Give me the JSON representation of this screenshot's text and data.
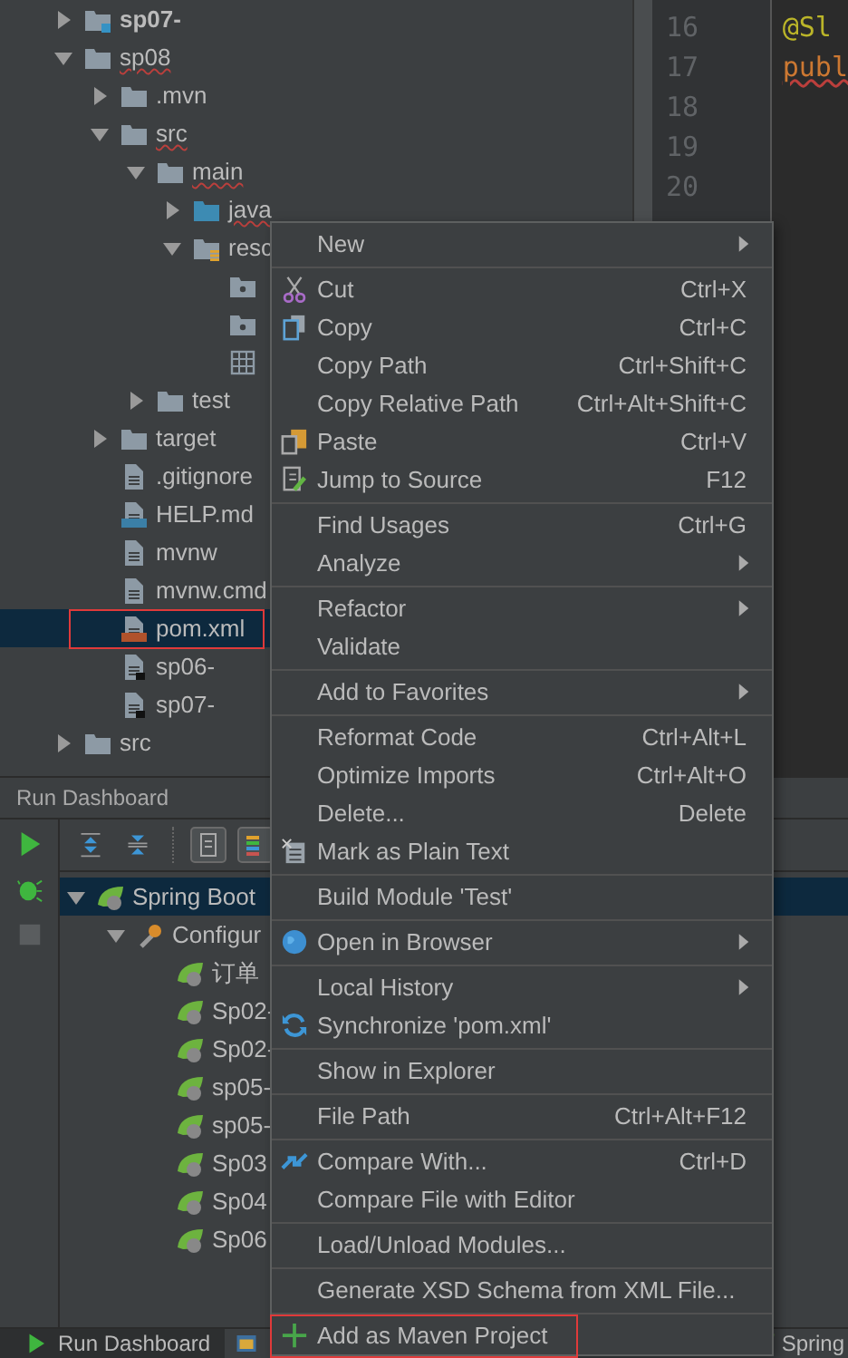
{
  "project_tree": [
    {
      "label": "sp07-",
      "kind": "module",
      "bold": true,
      "expanded": false,
      "selected": false
    },
    {
      "label": "sp08",
      "kind": "folder",
      "error": true,
      "expanded": true,
      "selected": false,
      "children": [
        {
          "label": ".mvn",
          "kind": "folder",
          "expanded": false,
          "selected": false
        },
        {
          "label": "src",
          "kind": "folder",
          "error": true,
          "expanded": true,
          "selected": false,
          "children": [
            {
              "label": "main",
              "kind": "folder",
              "error": true,
              "expanded": true,
              "selected": false,
              "children": [
                {
                  "label": "java",
                  "kind": "source",
                  "error": true,
                  "expanded": false,
                  "selected": false
                },
                {
                  "label": "resc",
                  "kind": "resources",
                  "expanded": true,
                  "selected": false,
                  "children": [
                    {
                      "kind": "package",
                      "selected": false
                    },
                    {
                      "kind": "package",
                      "selected": false
                    },
                    {
                      "kind": "table",
                      "selected": false
                    }
                  ]
                }
              ]
            },
            {
              "label": "test",
              "kind": "folder",
              "expanded": false,
              "selected": false
            }
          ]
        },
        {
          "label": "target",
          "kind": "folder",
          "expanded": false,
          "selected": false
        },
        {
          "label": ".gitignore",
          "kind": "file",
          "selected": false
        },
        {
          "label": "HELP.md",
          "kind": "md",
          "selected": false
        },
        {
          "label": "mvnw",
          "kind": "file",
          "selected": false
        },
        {
          "label": "mvnw.cmd",
          "kind": "file",
          "selected": false
        },
        {
          "label": "pom.xml",
          "kind": "xml",
          "selected": true,
          "marked": true
        },
        {
          "label": "sp06-",
          "kind": "module-file",
          "selected": false
        },
        {
          "label": "sp07-",
          "kind": "module-file",
          "selected": false
        }
      ]
    },
    {
      "label": "src",
      "kind": "folder",
      "expanded": false,
      "selected": false
    }
  ],
  "editor": {
    "line_numbers": [
      "16",
      "17",
      "18",
      "19",
      "20"
    ],
    "code_lines": [
      {
        "text": "@Sl",
        "kind": "annotation"
      },
      {
        "text": "publ",
        "kind": "keyword",
        "error": true
      }
    ]
  },
  "run_dashboard": {
    "title": "Run Dashboard",
    "tree": [
      {
        "label": "Spring Boot",
        "kind": "spring",
        "expanded": true,
        "selected": true,
        "children": [
          {
            "label": "Configur",
            "kind": "wrench",
            "expanded": true,
            "selected": false,
            "children": [
              {
                "label": "订单",
                "kind": "spring-app",
                "selected": false
              },
              {
                "label": "Sp02-",
                "kind": "spring-app",
                "selected": false
              },
              {
                "label": "Sp02-",
                "kind": "spring-app",
                "selected": false
              },
              {
                "label": "sp05-",
                "kind": "spring-app",
                "selected": false
              },
              {
                "label": "sp05-",
                "kind": "spring-app",
                "selected": false
              },
              {
                "label": "Sp03",
                "kind": "spring-app",
                "selected": false
              },
              {
                "label": "Sp04",
                "kind": "spring-app",
                "selected": false
              },
              {
                "label": "Sp06",
                "kind": "spring-app",
                "selected": false
              }
            ]
          }
        ]
      }
    ]
  },
  "context_menu": [
    [
      {
        "label": "New",
        "submenu": true
      }
    ],
    [
      {
        "label": "Cut",
        "shortcut": "Ctrl+X",
        "kind": "cut",
        "submenu": false
      },
      {
        "label": "Copy",
        "shortcut": "Ctrl+C",
        "kind": "copy",
        "submenu": false
      },
      {
        "label": "Copy Path",
        "shortcut": "Ctrl+Shift+C",
        "submenu": false
      },
      {
        "label": "Copy Relative Path",
        "shortcut": "Ctrl+Alt+Shift+C",
        "submenu": false
      },
      {
        "label": "Paste",
        "shortcut": "Ctrl+V",
        "kind": "paste",
        "submenu": false
      },
      {
        "label": "Jump to Source",
        "shortcut": "F12",
        "kind": "edit",
        "submenu": false
      }
    ],
    [
      {
        "label": "Find Usages",
        "shortcut": "Ctrl+G",
        "submenu": false
      },
      {
        "label": "Analyze",
        "submenu": true
      }
    ],
    [
      {
        "label": "Refactor",
        "submenu": true
      },
      {
        "label": "Validate",
        "submenu": false
      }
    ],
    [
      {
        "label": "Add to Favorites",
        "submenu": true
      }
    ],
    [
      {
        "label": "Reformat Code",
        "shortcut": "Ctrl+Alt+L",
        "submenu": false
      },
      {
        "label": "Optimize Imports",
        "shortcut": "Ctrl+Alt+O",
        "submenu": false
      },
      {
        "label": "Delete...",
        "shortcut": "Delete",
        "submenu": false
      },
      {
        "label": "Mark as Plain Text",
        "kind": "plain-text",
        "submenu": false
      }
    ],
    [
      {
        "label": "Build Module 'Test'",
        "submenu": false
      }
    ],
    [
      {
        "label": "Open in Browser",
        "kind": "globe",
        "submenu": true
      }
    ],
    [
      {
        "label": "Local History",
        "submenu": true
      },
      {
        "label": "Synchronize 'pom.xml'",
        "kind": "sync",
        "submenu": false
      }
    ],
    [
      {
        "label": "Show in Explorer",
        "submenu": false
      }
    ],
    [
      {
        "label": "File Path",
        "shortcut": "Ctrl+Alt+F12",
        "submenu": false
      }
    ],
    [
      {
        "label": "Compare With...",
        "shortcut": "Ctrl+D",
        "kind": "compare",
        "submenu": false
      },
      {
        "label": "Compare File with Editor",
        "submenu": false
      }
    ],
    [
      {
        "label": "Load/Unload Modules...",
        "submenu": false
      }
    ],
    [
      {
        "label": "Generate XSD Schema from XML File...",
        "submenu": false
      }
    ],
    [
      {
        "label": "Add as Maven Project",
        "kind": "plus",
        "submenu": false,
        "marked": true
      }
    ]
  ],
  "bottom_bar": {
    "tab": "Run Dashboard",
    "right_label": "Spring"
  }
}
